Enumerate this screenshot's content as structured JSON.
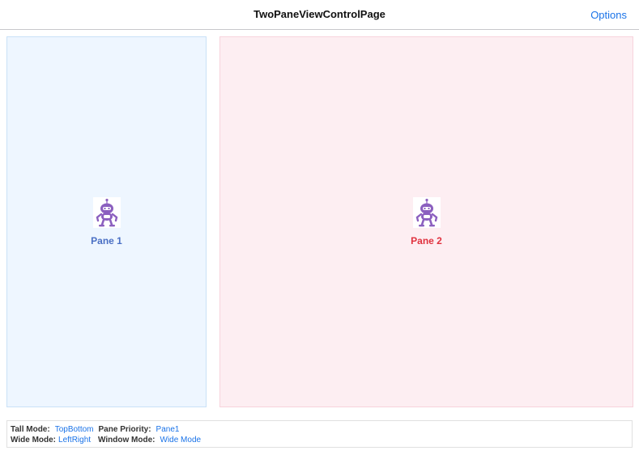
{
  "colors": {
    "accent": "#1a73e8",
    "pane1_background": "#eef6ff",
    "pane2_background": "#fdeef2",
    "pane1_label": "#4a6fc4",
    "pane2_label": "#e0323f",
    "bot": "#8b5fbf"
  },
  "navbar": {
    "title": "TwoPaneViewControlPage",
    "options_label": "Options"
  },
  "panes": {
    "pane1": {
      "label": "Pane 1",
      "icon": "dotnet-bot-icon"
    },
    "pane2": {
      "label": "Pane 2",
      "icon": "dotnet-bot-icon"
    }
  },
  "status": {
    "tall_mode_label": "Tall Mode:",
    "tall_mode_value": "TopBottom",
    "pane_priority_label": "Pane Priority:",
    "pane_priority_value": "Pane1",
    "wide_mode_label": "Wide Mode:",
    "wide_mode_value": "LeftRight",
    "window_mode_label": "Window Mode:",
    "window_mode_value": "Wide Mode"
  }
}
